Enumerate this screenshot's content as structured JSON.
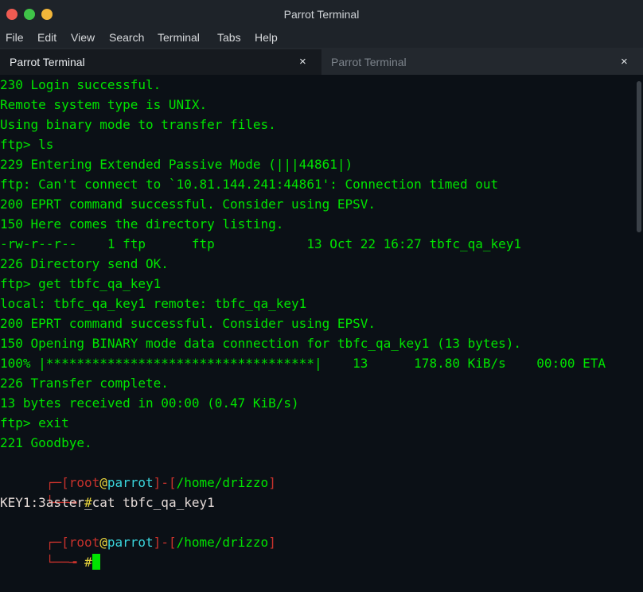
{
  "window": {
    "title": "Parrot Terminal"
  },
  "menu": [
    "File",
    "Edit",
    "View",
    "Search",
    "Terminal",
    "Tabs",
    "Help"
  ],
  "tabs": [
    {
      "label": "Parrot Terminal",
      "close": "×"
    },
    {
      "label": "Parrot Terminal",
      "close": "×"
    }
  ],
  "terminal": {
    "lines": [
      "230 Login successful.",
      "Remote system type is UNIX.",
      "Using binary mode to transfer files.",
      "ftp> ls",
      "229 Entering Extended Passive Mode (|||44861|)",
      "ftp: Can't connect to `10.81.144.241:44861': Connection timed out",
      "200 EPRT command successful. Consider using EPSV.",
      "150 Here comes the directory listing.",
      "-rw-r--r--    1 ftp      ftp            13 Oct 22 16:27 tbfc_qa_key1",
      "226 Directory send OK.",
      "ftp> get tbfc_qa_key1",
      "local: tbfc_qa_key1 remote: tbfc_qa_key1",
      "200 EPRT command successful. Consider using EPSV.",
      "150 Opening BINARY mode data connection for tbfc_qa_key1 (13 bytes).",
      "100% |***********************************|    13      178.80 KiB/s    00:00 ETA",
      "226 Transfer complete.",
      "13 bytes received in 00:00 (0.47 KiB/s)",
      "ftp> exit",
      "221 Goodbye."
    ],
    "prompt1": {
      "open": "[",
      "user": "root",
      "at": "@",
      "host": "parrot",
      "close": "]",
      "dash": "-",
      "path_open": "[",
      "path": "/home/drizzo",
      "path_close": "]",
      "hash": "#",
      "command": "cat tbfc_qa_key1"
    },
    "output": "KEY1:3aster_",
    "prompt2": {
      "open": "[",
      "user": "root",
      "at": "@",
      "host": "parrot",
      "close": "]",
      "dash": "-",
      "path_open": "[",
      "path": "/home/drizzo",
      "path_close": "]",
      "hash": "#",
      "command": ""
    }
  }
}
